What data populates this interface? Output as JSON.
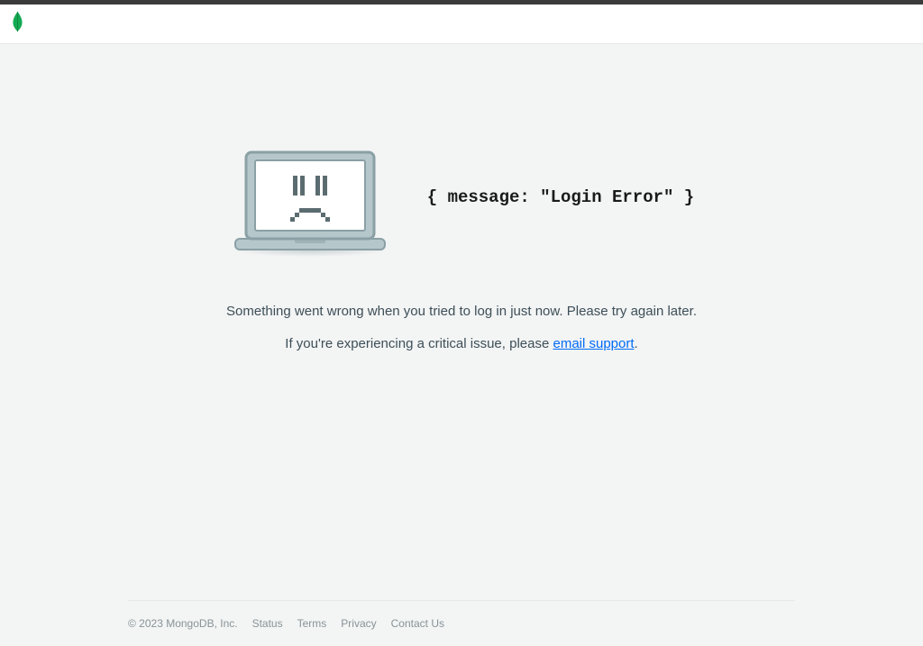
{
  "error": {
    "code_text": "{ message: \"Login Error\" }",
    "line1": "Something went wrong when you tried to log in just now. Please try again later.",
    "line2_prefix": "If you're experiencing a critical issue, please ",
    "email_link_text": "email support",
    "line2_suffix": "."
  },
  "footer": {
    "copyright": "© 2023 MongoDB, Inc.",
    "links": {
      "status": "Status",
      "terms": "Terms",
      "privacy": "Privacy",
      "contact": "Contact Us"
    }
  }
}
